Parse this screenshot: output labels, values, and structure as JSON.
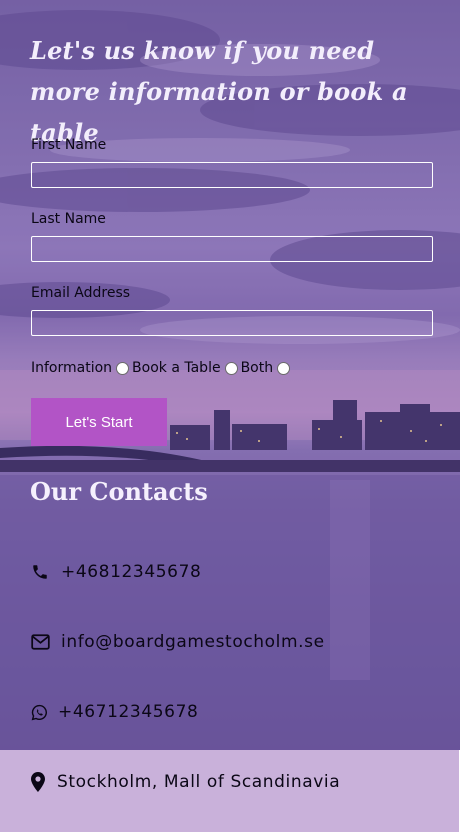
{
  "form": {
    "title": "Let's us know if you need more information or book a table",
    "first_name_label": "First Name",
    "last_name_label": "Last Name",
    "email_label": "Email Address",
    "radio_options": [
      "Information",
      "Book a Table",
      "Both"
    ],
    "submit_label": "Let's Start"
  },
  "contacts": {
    "title": "Our Contacts",
    "phone": "+46812345678",
    "email": "info@boardgamestocholm.se",
    "whatsapp": "+46712345678",
    "location": "Stockholm, Mall of Scandinavia"
  },
  "icons": {
    "phone": "phone-icon",
    "email": "envelope-icon",
    "whatsapp": "whatsapp-icon",
    "location": "map-marker-icon"
  },
  "colors": {
    "button": "#b254c6",
    "footer": "#c9b1da",
    "overlay": "#6a5699"
  }
}
